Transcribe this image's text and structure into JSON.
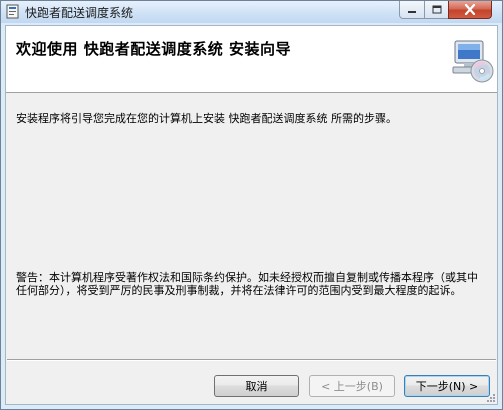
{
  "window": {
    "title": "快跑者配送调度系统",
    "controls": {
      "minimize": "minimize",
      "maximize": "maximize",
      "close": "close"
    }
  },
  "header": {
    "title": "欢迎使用  快跑者配送调度系统  安装向导",
    "icon": "computer-cd-icon"
  },
  "body": {
    "intro": "安装程序将引导您完成在您的计算机上安装 快跑者配送调度系统 所需的步骤。",
    "warning": "警告：本计算机程序受著作权法和国际条约保护。如未经授权而擅自复制或传播本程序（或其中任何部分），将受到严厉的民事及刑事制裁，并将在法律许可的范围内受到最大程度的起诉。"
  },
  "buttons": {
    "cancel": "取消",
    "back": "< 上一步(B)",
    "next": "下一步(N) >"
  },
  "colors": {
    "title_bar": "#cfe2f6",
    "close_button": "#c2432b",
    "header_bg": "#ffffff",
    "body_bg": "#f0f0f0"
  }
}
